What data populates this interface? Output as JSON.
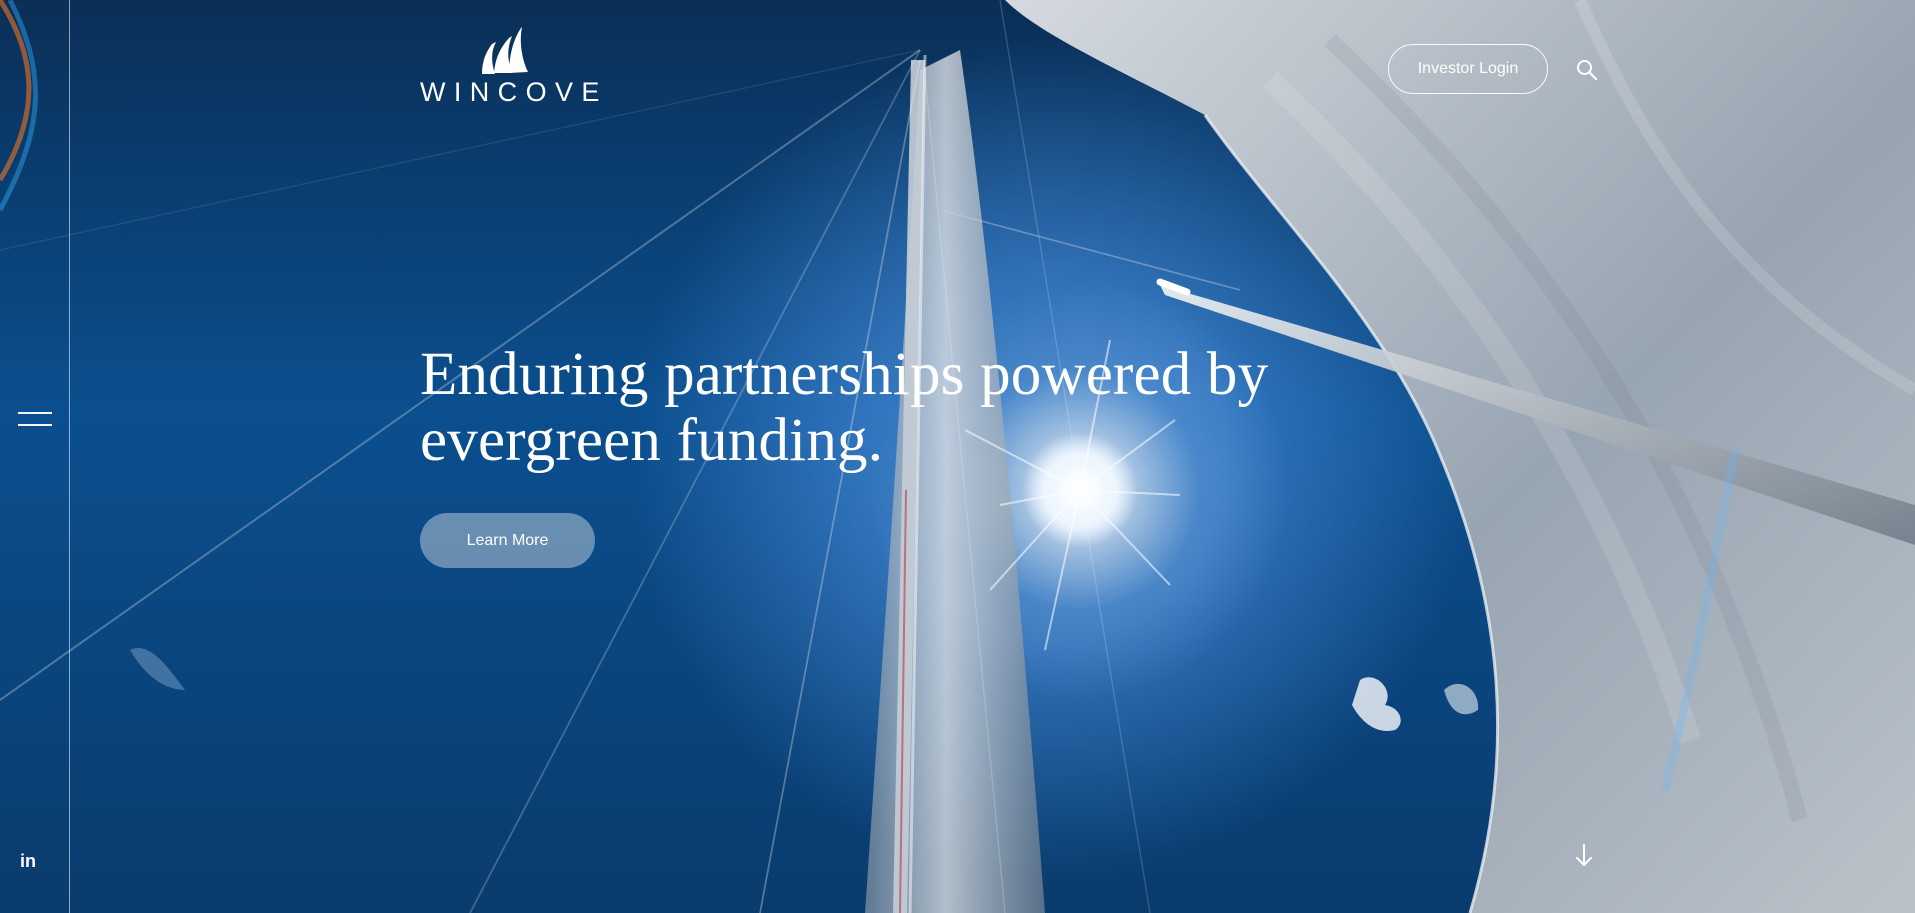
{
  "brand": {
    "name": "WINCOVE",
    "logo_icon": "sail-logo-icon"
  },
  "header": {
    "investor_login_label": "Investor Login",
    "search_icon": "search-icon"
  },
  "sidebar": {
    "menu_icon": "hamburger-menu-icon",
    "social_icon": "linkedin-icon",
    "social_label": "in"
  },
  "hero": {
    "headline": "Enduring partnerships powered by evergreen funding.",
    "cta_label": "Learn More",
    "scroll_icon": "down-arrow-icon"
  },
  "colors": {
    "sky_blue": "#0b4f8f",
    "deep_blue": "#0a2f57",
    "white": "#ffffff",
    "button_fill": "#a2b8cd"
  }
}
